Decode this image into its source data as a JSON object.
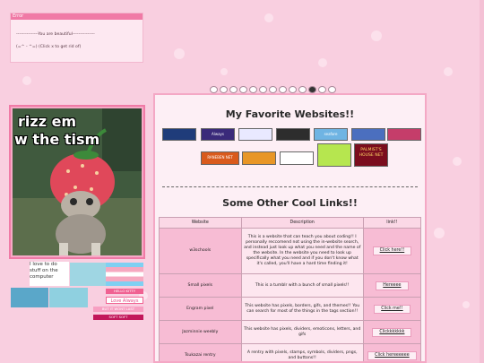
{
  "error_box": {
    "title": "Error",
    "message": "---------------You are beautiful---------------",
    "dismiss": "(=^ - ^=) (Click x to get rid of)"
  },
  "gif": {
    "caption_line1": "rizz em",
    "caption_line2": "w the tism"
  },
  "side": {
    "note": "I love to do stuff on the computer",
    "badges": [
      "HELLO KITTY",
      "Love Always",
      "BUT IT WONT LAST",
      "SOFT SOFT"
    ]
  },
  "main": {
    "title": "My Favorite Websites!!",
    "subtitle": "Some Other Cool Links!!",
    "site_buttons": [
      {
        "label": "",
        "color": "#1f3c7a"
      },
      {
        "label": "Always",
        "color": "#3a2a7a"
      },
      {
        "label": "",
        "color": "#e9e9ff"
      },
      {
        "label": "",
        "color": "#2d2d2d"
      },
      {
        "label": "seafare",
        "color": "#6fb4e3"
      },
      {
        "label": "",
        "color": "#4b6fbf"
      },
      {
        "label": "",
        "color": "#c53d6a"
      },
      {
        "label": "RANEBEN NET",
        "color": "#d95a1c"
      },
      {
        "label": "",
        "color": "#e89626"
      },
      {
        "label": "",
        "color": "#ffffff"
      },
      {
        "label": "",
        "color": "#b6e64f"
      },
      {
        "label": "PALMIST'S HOUSE NET",
        "color": "#7b0d1e"
      }
    ],
    "table": {
      "headers": [
        "Website",
        "Description",
        "link!!"
      ],
      "rows": [
        {
          "name": "w3schools",
          "desc": "This is a website that can teach you about coding!! I personally reccomend not using the in-website search, and instead just look up what you need and the name of the website. In the website you need to look up specifically what you need and if you don't know what it's called, you'll have a hard time finding it!",
          "link": "Click here!!"
        },
        {
          "name": "Small pixels",
          "desc": "This is a tumblr with a bunch of small pixels!!",
          "link": "Hereeee"
        },
        {
          "name": "Engram pixel",
          "desc": "This website has pixels, borders, gifs, and themes!! You can search for most of the things in the tags section!!",
          "link": "Click me!!"
        },
        {
          "name": "Jazminnie weebly",
          "desc": "This website has pixels, dividers, emoticons, letters, and gifs",
          "link": "Clickkkkkkk"
        },
        {
          "name": "Tsukazai rentry",
          "desc": "A rentry with pixels, stamps, symbols, dividers, pngs, and buttons!!",
          "link": "Click hereeeeee"
        }
      ]
    }
  },
  "colors": {
    "accent": "#f07aa6",
    "background": "#f9cfe0",
    "panel": "#fdeff5"
  }
}
